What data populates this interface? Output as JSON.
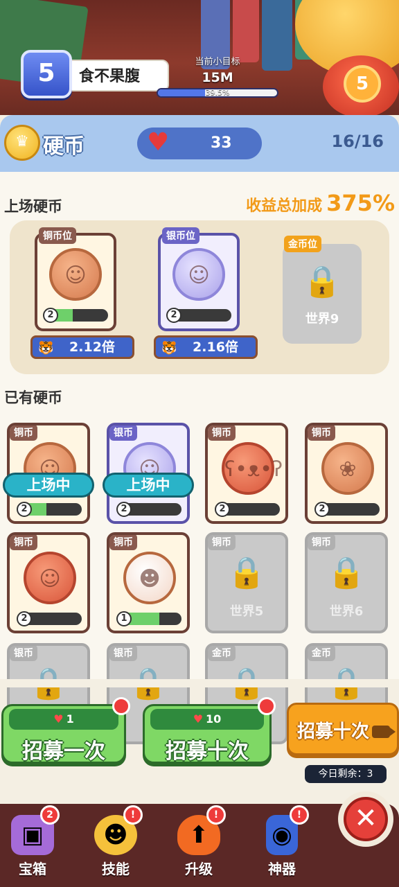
{
  "header": {
    "level": "5",
    "level_name": "食不果腹",
    "goal_title": "当前小目标",
    "goal_value": "15M",
    "goal_progress_text": "39.5%",
    "goal_progress": 0.395
  },
  "coin_header": {
    "title": "硬币",
    "hearts": "33",
    "capacity": "16/16"
  },
  "onfield": {
    "title": "上场硬币",
    "bonus_label": "收益总加成",
    "bonus_value": "375%",
    "slots": [
      {
        "tag": "铜币位",
        "level": "2",
        "progress": 0.45,
        "multiplier": "2.12倍"
      },
      {
        "tag": "银币位",
        "level": "2",
        "progress": 0.0,
        "multiplier": "2.16倍"
      },
      {
        "tag": "金币位",
        "locked_text": "世界9"
      }
    ]
  },
  "owned": {
    "title": "已有硬币",
    "onfield_label": "上场中",
    "cards": [
      {
        "tag": "铜币",
        "level": "2",
        "progress": 0.45,
        "icon": "woman-portrait"
      },
      {
        "tag": "银币",
        "level": "2",
        "progress": 0.0,
        "icon": "girl-portrait"
      },
      {
        "tag": "铜币",
        "level": "2",
        "progress": 0.0,
        "icon": "bear-face"
      },
      {
        "tag": "铜币",
        "level": "2",
        "progress": 0.0,
        "icon": "hamster"
      },
      {
        "tag": "铜币",
        "level": "2",
        "progress": 0.0,
        "icon": "man-portrait"
      },
      {
        "tag": "铜币",
        "level": "1",
        "progress": 0.65,
        "icon": "baby-portrait"
      },
      {
        "tag": "铜币",
        "locked_text": "世界5"
      },
      {
        "tag": "铜币",
        "locked_text": "世界6"
      },
      {
        "tag": "银币"
      },
      {
        "tag": "银币"
      },
      {
        "tag": "金币"
      },
      {
        "tag": "金币"
      }
    ]
  },
  "recruit": {
    "once_cost": "1",
    "once_label": "招募一次",
    "ten_cost": "10",
    "ten_label": "招募十次",
    "ad_label": "招募十次",
    "remaining": "今日剩余：3"
  },
  "nav": {
    "items": [
      {
        "label": "宝箱",
        "badge": "2"
      },
      {
        "label": "技能",
        "badge": "!"
      },
      {
        "label": "升级",
        "badge": "!"
      },
      {
        "label": "神器",
        "badge": "!"
      }
    ],
    "close_label": "✕"
  },
  "colors": {
    "accent_orange": "#f29a18",
    "green_button": "#7fd865",
    "blue_header": "#a9c8ee",
    "copper_border": "#6b4036",
    "silver_border": "#5a52a8"
  }
}
